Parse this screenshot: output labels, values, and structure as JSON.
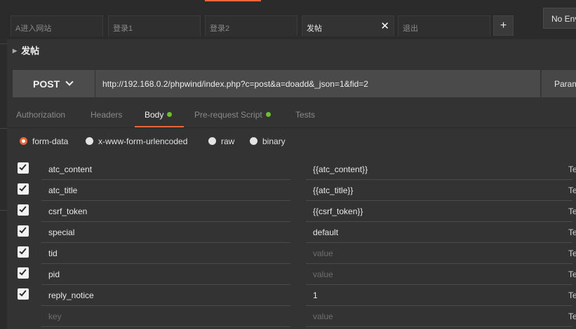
{
  "tabs": [
    {
      "label": "A进入网站",
      "active": false
    },
    {
      "label": "登录1",
      "active": false
    },
    {
      "label": "登录2",
      "active": false
    },
    {
      "label": "发帖",
      "active": true,
      "close": "✕"
    },
    {
      "label": "退出",
      "active": false
    }
  ],
  "add_tab_label": "+",
  "environment_label": "No Env",
  "request_name": "发帖",
  "method": "POST",
  "url": "http://192.168.0.2/phpwind/index.php?c=post&a=doadd&_json=1&fid=2",
  "params_label": "Params",
  "subtabs": {
    "authorization": "Authorization",
    "headers": "Headers",
    "body": "Body",
    "prerequest": "Pre-request Script",
    "tests": "Tests"
  },
  "body_modes": {
    "form_data": "form-data",
    "urlencoded": "x-www-form-urlencoded",
    "raw": "raw",
    "binary": "binary",
    "selected": "form-data"
  },
  "form_rows": [
    {
      "key": "atc_content",
      "value": "{{atc_content}}",
      "type": "Te",
      "checked": true
    },
    {
      "key": "atc_title",
      "value": "{{atc_title}}",
      "type": "Te",
      "checked": true
    },
    {
      "key": "csrf_token",
      "value": "{{csrf_token}}",
      "type": "Te",
      "checked": true
    },
    {
      "key": "special",
      "value": "default",
      "type": "Te",
      "checked": true
    },
    {
      "key": "tid",
      "value": "",
      "value_placeholder": "value",
      "type": "Te",
      "checked": true
    },
    {
      "key": "pid",
      "value": "",
      "value_placeholder": "value",
      "type": "Te",
      "checked": true
    },
    {
      "key": "reply_notice",
      "value": "1",
      "type": "Te",
      "checked": true
    },
    {
      "key": "",
      "key_placeholder": "key",
      "value": "",
      "value_placeholder": "value",
      "type": "Te",
      "checked": false
    }
  ],
  "colors": {
    "accent": "#e8673c",
    "indicator": "#6fbf2a",
    "background": "#333333"
  }
}
